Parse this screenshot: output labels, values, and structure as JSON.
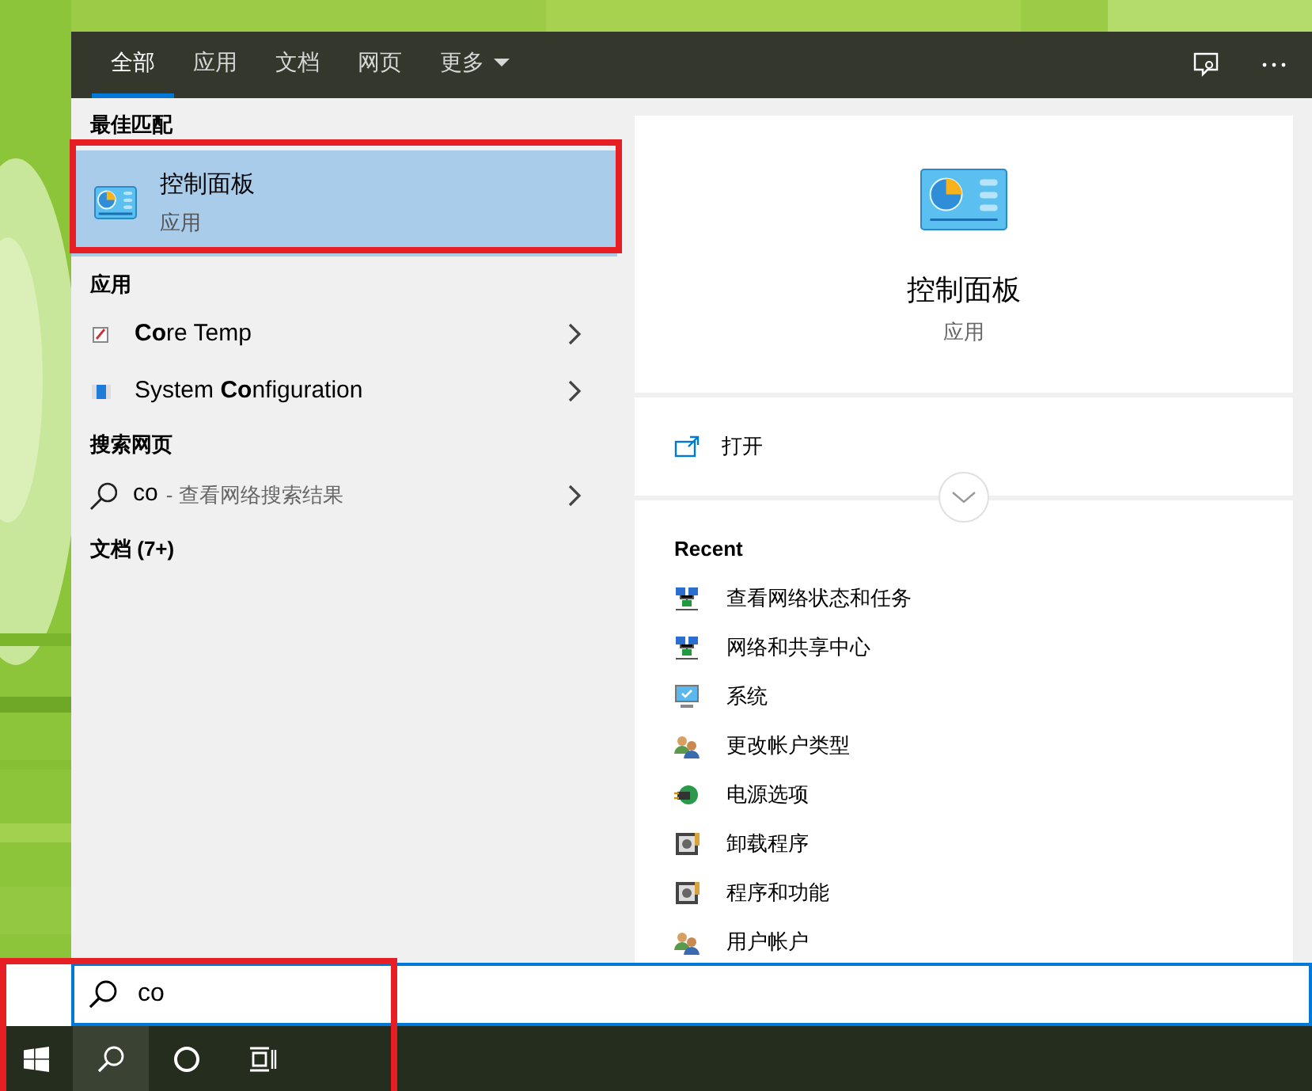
{
  "tabs": [
    {
      "label": "全部",
      "selected": true,
      "kind": "plain"
    },
    {
      "label": "应用",
      "selected": false,
      "kind": "plain"
    },
    {
      "label": "文档",
      "selected": false,
      "kind": "plain"
    },
    {
      "label": "网页",
      "selected": false,
      "kind": "plain"
    },
    {
      "label": "更多",
      "selected": false,
      "kind": "dropdown"
    }
  ],
  "best_match": {
    "heading": "最佳匹配",
    "title": "控制面板",
    "subtitle": "应用",
    "selected": true
  },
  "apps": {
    "heading": "应用",
    "items": [
      {
        "label": "**Co**re Temp",
        "kind": "coretemp"
      },
      {
        "label": "System **Co**nfiguration",
        "kind": "msconfig"
      }
    ]
  },
  "web": {
    "heading": "搜索网页",
    "query": "co",
    "suffix": "- 查看网络搜索结果"
  },
  "documents": {
    "heading": "文档 (7+)"
  },
  "preview": {
    "title": "控制面板",
    "subtitle": "应用",
    "action": "打开",
    "recent_heading": "Recent",
    "recent": [
      {
        "label": "查看网络状态和任务",
        "kind": "network"
      },
      {
        "label": "网络和共享中心",
        "kind": "network"
      },
      {
        "label": "系统",
        "kind": "system"
      },
      {
        "label": "更改帐户类型",
        "kind": "users"
      },
      {
        "label": "电源选项",
        "kind": "power"
      },
      {
        "label": "卸载程序",
        "kind": "programs"
      },
      {
        "label": "程序和功能",
        "kind": "programs"
      },
      {
        "label": "用户帐户",
        "kind": "users"
      }
    ]
  },
  "search": {
    "value": "co"
  }
}
